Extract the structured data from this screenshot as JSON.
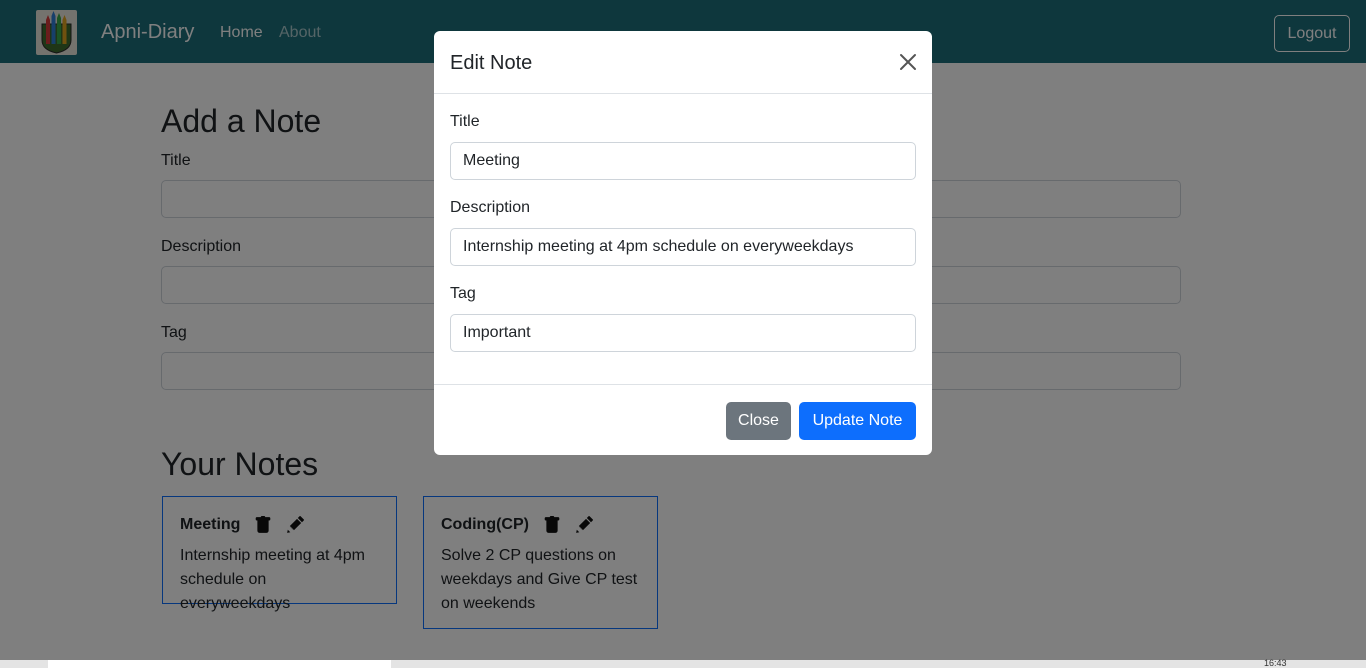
{
  "navbar": {
    "brand": "Apni-Diary",
    "links": [
      "Home",
      "About"
    ],
    "logout_label": "Logout"
  },
  "add_note": {
    "heading": "Add a Note",
    "title_label": "Title",
    "description_label": "Description",
    "tag_label": "Tag"
  },
  "notes_section": {
    "heading": "Your Notes",
    "notes": [
      {
        "title": "Meeting",
        "description": "Internship meeting at 4pm schedule on everyweekdays"
      },
      {
        "title": "Coding(CP)",
        "description": "Solve 2 CP questions on weekdays and Give CP test on weekends"
      }
    ]
  },
  "edit_modal": {
    "title": "Edit Note",
    "title_label": "Title",
    "title_value": "Meeting",
    "description_label": "Description",
    "description_value": "Internship meeting at 4pm schedule on everyweekdays",
    "tag_label": "Tag",
    "tag_value": "Important",
    "close_label": "Close",
    "update_label": "Update Note"
  },
  "taskbar": {
    "time": "16:43"
  },
  "colors": {
    "navbar": "#1d6f7b",
    "primary": "#0d6efd",
    "secondary": "#6c757d",
    "backdrop": "rgba(0,0,0,0.5)"
  }
}
